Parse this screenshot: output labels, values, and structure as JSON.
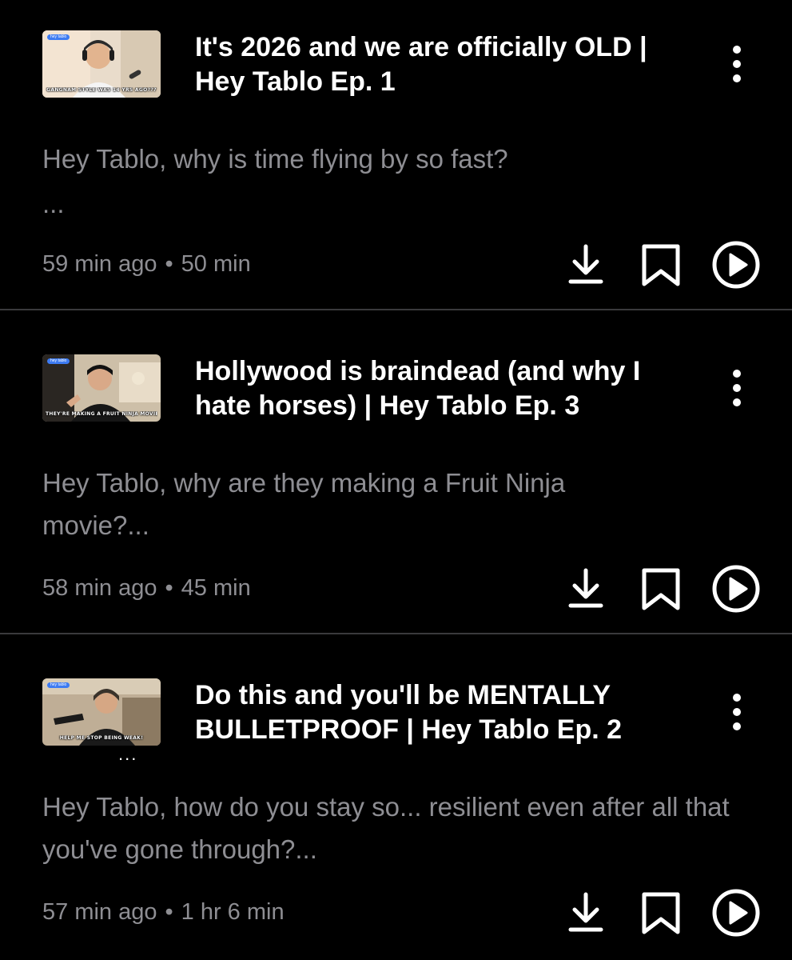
{
  "colors": {
    "background": "#000000",
    "title": "#ffffff",
    "secondary_text": "#8e8e93",
    "divider": "#3a3a3c",
    "thumb_pill": "#3d7bf2"
  },
  "episodes": [
    {
      "thumbnail": {
        "pill": "hey tablo",
        "caption": "GANGNAM STYLE WAS 14 YRS AGO???",
        "icon": "podcast-host-thumbnail"
      },
      "title": "It's 2026 and we are officially OLD | Hey Tablo Ep. 1",
      "description": "Hey Tablo, why is time flying by so fast?",
      "description_more": "...",
      "published": "59 min ago",
      "separator": "•",
      "duration": "50 min",
      "actions": [
        "download-icon",
        "bookmark-icon",
        "play-circle-icon"
      ]
    },
    {
      "thumbnail": {
        "pill": "hey tablo",
        "caption": "THEY'RE MAKING A FRUIT NINJA MOVIE... I'M DONE",
        "icon": "podcast-host-thumbnail"
      },
      "title": "Hollywood is braindead (and why I hate horses) | Hey Tablo Ep. 3",
      "description": "Hey Tablo, why are they making a Fruit Ninja movie?...",
      "description_more": "",
      "published": "58 min ago",
      "separator": "•",
      "duration": "45 min",
      "actions": [
        "download-icon",
        "bookmark-icon",
        "play-circle-icon"
      ]
    },
    {
      "thumbnail": {
        "pill": "hey tablo",
        "caption": "HELP ME STOP BEING WEAK!",
        "icon": "podcast-host-thumbnail"
      },
      "title": "Do this and you'll be MENTALLY BULLETPROOF | Hey Tablo Ep. 2",
      "description": "Hey Tablo, how do you stay so... resilient even after all that you've gone through?...",
      "description_more": "",
      "published": "57 min ago",
      "separator": "•",
      "duration": "1 hr 6 min",
      "actions": [
        "download-icon",
        "bookmark-icon",
        "play-circle-icon"
      ]
    }
  ],
  "thumbnail_overflow": "..."
}
